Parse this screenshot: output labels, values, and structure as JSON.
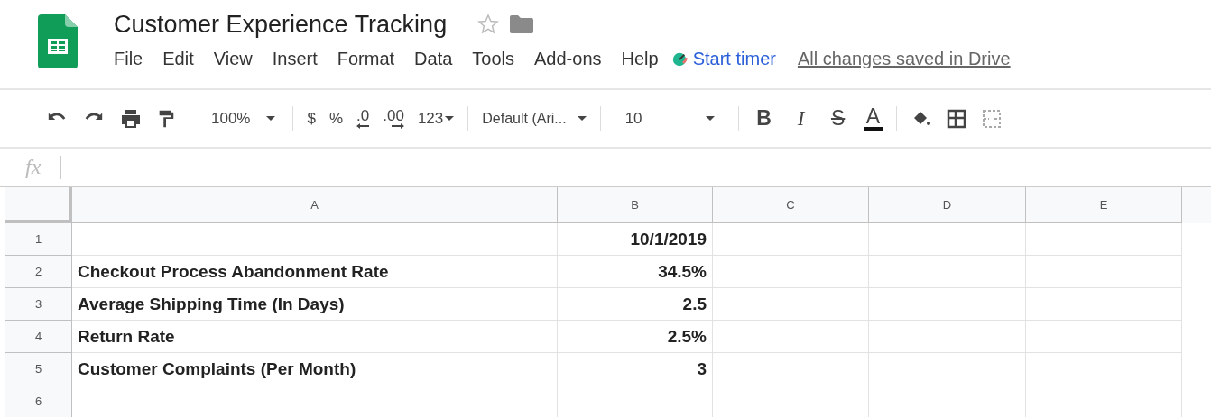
{
  "document": {
    "title": "Customer Experience Tracking"
  },
  "menu": [
    "File",
    "Edit",
    "View",
    "Insert",
    "Format",
    "Data",
    "Tools",
    "Add-ons",
    "Help"
  ],
  "timer": "Start timer",
  "save_status": "All changes saved in Drive",
  "toolbar": {
    "zoom": "100%",
    "currency": "$",
    "percent": "%",
    "decrease_decimals": ".0",
    "increase_decimals": ".00",
    "more_formats": "123",
    "font": "Default (Ari...",
    "font_size": "10",
    "bold": "B",
    "italic": "I",
    "strikethrough": "S",
    "text_color": "A"
  },
  "formula_bar": {
    "label": "fx"
  },
  "sheet": {
    "columns": [
      "A",
      "B",
      "C",
      "D",
      "E"
    ],
    "rows": [
      {
        "number": "1",
        "value": "10/1/2019"
      },
      {
        "number": "2",
        "label": "Checkout Process Abandonment Rate",
        "value": "34.5%"
      },
      {
        "number": "3",
        "label": "Average Shipping Time (In Days)",
        "value": "2.5"
      },
      {
        "number": "4",
        "label": "Return Rate",
        "value": "2.5%"
      },
      {
        "number": "5",
        "label": "Customer Complaints (Per Month)",
        "value": "3"
      },
      {
        "number": "6"
      }
    ]
  }
}
